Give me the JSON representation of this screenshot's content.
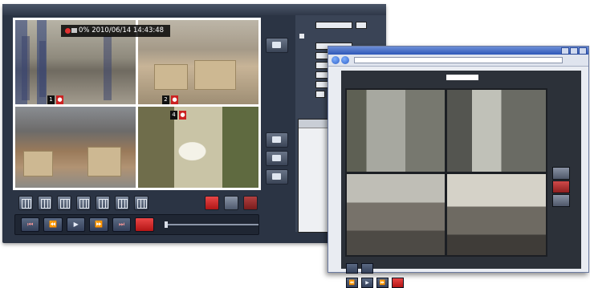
{
  "dvr": {
    "osd": {
      "percent": "0%",
      "date": "2010/06/14",
      "time": "14:43:48"
    },
    "layout_buttons": [
      "single-view",
      "quad-view",
      "six-view",
      "nine-view",
      "eight-view",
      "thirteen-view",
      "sixteen-view"
    ],
    "transport": {
      "buttons": [
        "⏮",
        "⏪",
        "▶",
        "⏩",
        "⏭"
      ],
      "stop_color": "#d42020"
    }
  },
  "browser": {
    "toolbar_accent": "#2f58b8"
  },
  "colors": {
    "dvr_background": "#2b3444",
    "record_red": "#e03030"
  }
}
